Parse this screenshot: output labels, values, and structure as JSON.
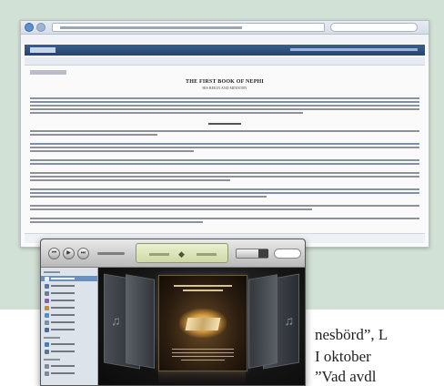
{
  "document": {
    "title": "THE FIRST BOOK OF NEPHI",
    "byline": "HIS REIGN AND MINISTRY",
    "section_heading": "CHAPTER 1"
  },
  "colors": {
    "background_panel": "#d2e1d6",
    "browser_header": "#27446e",
    "itunes_selected": "#6b8fc0"
  },
  "itunes": {
    "lcd_icon": "apple-icon",
    "transport": [
      "⏮",
      "▶",
      "⏭"
    ]
  },
  "article": {
    "line1": "nesbörd”, L",
    "line2": "I oktober",
    "line3": "”Vad avdl"
  }
}
